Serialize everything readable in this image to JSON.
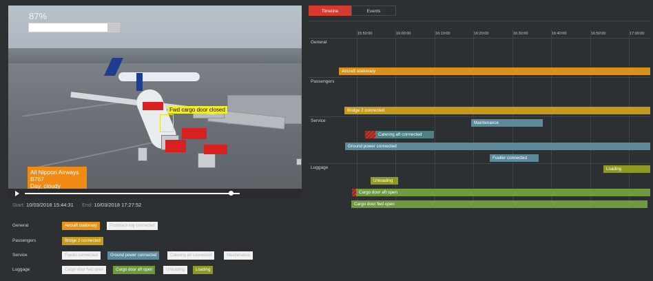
{
  "video": {
    "progress_text": "87%",
    "progress": 0.87,
    "detection_label": "Fwd cargo door closed",
    "info_lines": [
      "All Nippon Airways",
      "B767",
      "Day, cloudy"
    ],
    "playback_position": 0.95
  },
  "times": {
    "start_label": "Start:",
    "start_value": "10/03/2018 15:44:31",
    "end_label": "End:",
    "end_value": "10/03/2018 17:27:52"
  },
  "status": {
    "rows": [
      {
        "label": "General",
        "chips": [
          {
            "text": "Aircraft stationary",
            "state": "orange"
          },
          {
            "text": "Pushback tug connected",
            "state": "off"
          }
        ]
      },
      {
        "label": "Passengers",
        "chips": [
          {
            "text": "Bridge 2 connected",
            "state": "gold"
          }
        ]
      },
      {
        "label": "Service",
        "chips": [
          {
            "text": "Fueller connected",
            "state": "off"
          },
          {
            "text": "Ground power connected",
            "state": "teal"
          },
          {
            "text": "Catering aft connected",
            "state": "off"
          },
          {
            "text": "Maintenance",
            "state": "off"
          }
        ]
      },
      {
        "label": "Luggage",
        "chips": [
          {
            "text": "Cargo door fwd open",
            "state": "off"
          },
          {
            "text": "Cargo door aft open",
            "state": "green"
          },
          {
            "text": "Unloading",
            "state": "off"
          },
          {
            "text": "Loading",
            "state": "olive"
          }
        ]
      }
    ]
  },
  "tabs": [
    {
      "label": "Timeline",
      "active": true
    },
    {
      "label": "Events",
      "active": false
    }
  ],
  "timeline": {
    "ticks": [
      "15:50:00",
      "16:00:00",
      "16:10:00",
      "16:20:00",
      "16:30:00",
      "16:40:00",
      "16:50:00",
      "17:00:00"
    ],
    "sections": [
      "General",
      "Passengers",
      "Service",
      "Luggage"
    ],
    "bars": [
      {
        "label": "Aircraft stationary",
        "color": "orange"
      },
      {
        "label": "Bridge 2 connected",
        "color": "gold"
      },
      {
        "label": "Maintenance",
        "color": "teal"
      },
      {
        "label": "Catering aft connected",
        "color": "teal2"
      },
      {
        "label": "Ground power connected",
        "color": "teal"
      },
      {
        "label": "Fueller connected",
        "color": "teal"
      },
      {
        "label": "Loading",
        "color": "olive"
      },
      {
        "label": "Unloading",
        "color": "olive"
      },
      {
        "label": "Cargo door aft open",
        "color": "green"
      },
      {
        "label": "Cargo door fwd open",
        "color": "green"
      }
    ]
  },
  "colors": {
    "background": "#2d3033",
    "accent_red": "#d63a2f",
    "orange": "#d7921a",
    "teal": "#5b8a9b",
    "green": "#6f9a3f",
    "olive": "#8e9a22"
  }
}
